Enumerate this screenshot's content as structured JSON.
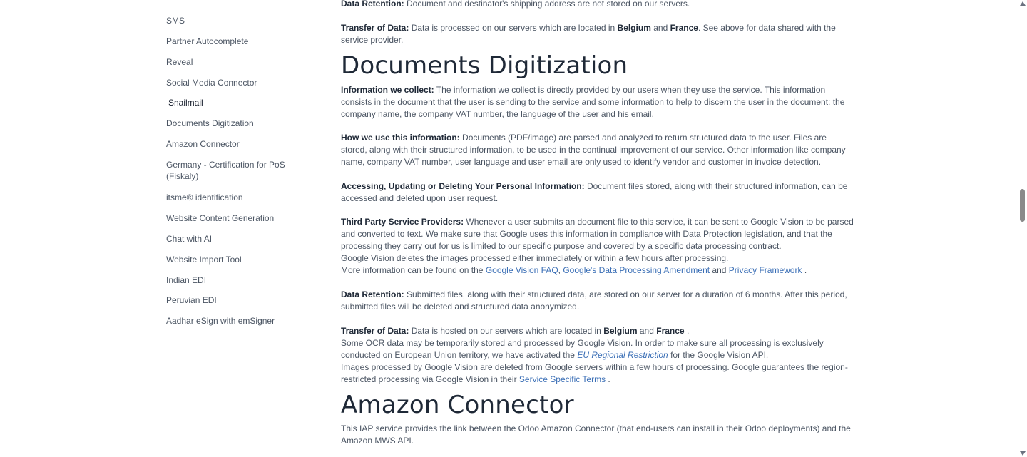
{
  "sidebar": {
    "items": [
      {
        "label": "SMS"
      },
      {
        "label": "Partner Autocomplete"
      },
      {
        "label": "Reveal"
      },
      {
        "label": "Social Media Connector"
      },
      {
        "label": "Snailmail"
      },
      {
        "label": "Documents Digitization"
      },
      {
        "label": "Amazon Connector"
      },
      {
        "label": "Germany - Certification for PoS (Fiskaly)"
      },
      {
        "label": "itsme® identification"
      },
      {
        "label": "Website Content Generation"
      },
      {
        "label": "Chat with AI"
      },
      {
        "label": "Website Import Tool"
      },
      {
        "label": "Indian EDI"
      },
      {
        "label": "Peruvian EDI"
      },
      {
        "label": "Aadhar eSign with emSigner"
      }
    ],
    "active_index": 4
  },
  "snailmail": {
    "retention_label": "Data Retention:",
    "retention_text": "Document and destinator's shipping address are not stored on our servers.",
    "transfer_label": "Transfer of Data:",
    "transfer_pre": "Data is processed on our servers which are located in",
    "belgium": "Belgium",
    "and": "and",
    "france": "France",
    "transfer_post": ". See above for data shared with the service provider."
  },
  "docdig": {
    "title": "Documents Digitization",
    "collect_label": "Information we collect:",
    "collect_text": "The information we collect is directly provided by our users when they use the service. This information consists in the document that the user is sending to the service and some information to help to discern the user in the document: the company name, the company VAT number, the language of the user and his email.",
    "use_label": "How we use this information:",
    "use_text": "Documents (PDF/image) are parsed and analyzed to return structured data to the user. Files are stored, along with their structured information, to be used in the continual improvement of our service. Other information like company name, company VAT number, user language and user email are only used to identify vendor and customer in invoice detection.",
    "access_label": "Accessing, Updating or Deleting Your Personal Information:",
    "access_text": "Document files stored, along with their structured information, can be accessed and deleted upon user request.",
    "third_label": "Third Party Service Providers:",
    "third_text": "Whenever a user submits an document file to this service, it can be sent to Google Vision to be parsed and converted to text. We make sure that Google uses this information in compliance with Data Protection legislation, and that the processing they carry out for us is limited to our specific purpose and covered by a specific data processing contract.",
    "third_line2": "Google Vision deletes the images processed either immediately or within a few hours after processing.",
    "more_pre": "More information can be found on the",
    "link_faq": "Google Vision FAQ",
    "comma": ",",
    "link_dpa": "Google's Data Processing Amendment",
    "and": "and",
    "link_privacy": "Privacy Framework",
    "period": ".",
    "retention_label": "Data Retention:",
    "retention_text": "Submitted files, along with their structured data, are stored on our server for a duration of 6 months. After this period, submitted files will be deleted and structured data anonymized.",
    "transfer_label": "Transfer of Data:",
    "transfer_pre": "Data is hosted on our servers which are located in",
    "belgium": "Belgium",
    "france": "France",
    "ocr_pre": "Some OCR data may be temporarily stored and processed by Google Vision. In order to make sure all processing is exclusively conducted on European Union territory, we have activated the",
    "eu_link": "EU Regional Restriction",
    "ocr_post": "for the Google Vision API.",
    "images_pre": "Images processed by Google Vision are deleted from Google servers within a few hours of processing. Google guarantees the region-restricted processing via Google Vision in their",
    "terms_link": "Service Specific Terms"
  },
  "amazon": {
    "title": "Amazon Connector",
    "text": "This IAP service provides the link between the Odoo Amazon Connector (that end-users can install in their Odoo deployments) and the Amazon MWS API."
  }
}
